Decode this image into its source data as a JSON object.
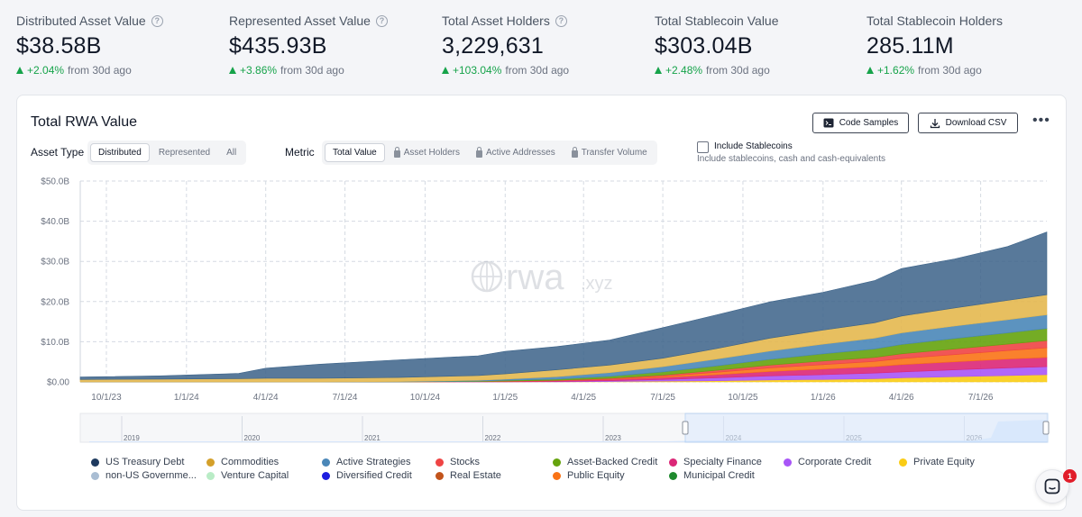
{
  "stats": [
    {
      "label": "Distributed Asset Value",
      "info": true,
      "value": "$38.58B",
      "change": "+2.04%",
      "suffix": "from 30d ago"
    },
    {
      "label": "Represented Asset Value",
      "info": true,
      "value": "$435.93B",
      "change": "+3.86%",
      "suffix": "from 30d ago"
    },
    {
      "label": "Total Asset Holders",
      "info": true,
      "value": "3,229,631",
      "change": "+103.04%",
      "suffix": "from 30d ago"
    },
    {
      "label": "Total Stablecoin Value",
      "info": false,
      "value": "$303.04B",
      "change": "+2.48%",
      "suffix": "from 30d ago"
    },
    {
      "label": "Total Stablecoin Holders",
      "info": false,
      "value": "285.11M",
      "change": "+1.62%",
      "suffix": "from 30d ago"
    }
  ],
  "card": {
    "title": "Total RWA Value",
    "code_samples": "Code Samples",
    "download_csv": "Download CSV",
    "more": "•••"
  },
  "controls": {
    "asset_type_label": "Asset Type",
    "asset_type_options": [
      "Distributed",
      "Represented",
      "All"
    ],
    "asset_type_selected": "Distributed",
    "metric_label": "Metric",
    "metric_options": [
      "Total Value",
      "Asset Holders",
      "Active Addresses",
      "Transfer Volume"
    ],
    "metric_selected": "Total Value",
    "include_stablecoins_label": "Include Stablecoins",
    "include_stablecoins_sub": "Include stablecoins, cash and cash-equivalents",
    "include_stablecoins_checked": false
  },
  "watermark": {
    "main": "rwa",
    "suffix": ".xyz"
  },
  "chart_data": {
    "type": "area",
    "stacked": true,
    "ylim": [
      0,
      50
    ],
    "y_ticks": [
      0,
      10,
      20,
      30,
      40,
      50
    ],
    "y_tick_labels": [
      "$0.00",
      "$10.0B",
      "$20.0B",
      "$30.0B",
      "$40.0B",
      "$50.0B"
    ],
    "x_ticks": [
      "2023-10-01",
      "2024-01-01",
      "2024-04-01",
      "2024-07-01",
      "2024-10-01",
      "2025-01-01",
      "2025-04-01",
      "2025-07-01",
      "2025-10-01",
      "2026-01-01",
      "2026-04-01",
      "2026-07-01"
    ],
    "x_tick_labels": [
      "10/1/23",
      "1/1/24",
      "4/1/24",
      "7/1/24",
      "10/1/24",
      "1/1/25",
      "4/1/25",
      "7/1/25",
      "10/1/25",
      "1/1/26",
      "4/1/26",
      "7/1/26"
    ],
    "x_range": [
      "2023-09-01",
      "2026-09-15"
    ],
    "grid": true,
    "x": [
      "2023-09-01",
      "2023-12-01",
      "2024-03-01",
      "2024-04-01",
      "2024-06-01",
      "2024-09-01",
      "2024-12-01",
      "2025-01-01",
      "2025-03-01",
      "2025-05-01",
      "2025-07-01",
      "2025-09-01",
      "2025-11-01",
      "2026-01-01",
      "2026-03-01",
      "2026-04-01",
      "2026-06-01",
      "2026-08-01",
      "2026-09-15"
    ],
    "series": [
      {
        "name": "Private Equity",
        "color": "#facc15",
        "values": [
          0,
          0,
          0,
          0,
          0,
          0,
          0,
          0,
          0,
          0.1,
          0.2,
          0.3,
          0.5,
          0.6,
          0.8,
          1.0,
          1.3,
          1.6,
          1.8
        ]
      },
      {
        "name": "Corporate Credit",
        "color": "#a855f7",
        "values": [
          0,
          0,
          0,
          0,
          0,
          0,
          0,
          0,
          0.1,
          0.2,
          0.4,
          0.7,
          1.0,
          1.2,
          1.4,
          1.5,
          1.7,
          1.9,
          2.0
        ]
      },
      {
        "name": "Specialty Finance",
        "color": "#db2777",
        "values": [
          0,
          0,
          0,
          0,
          0,
          0,
          0.1,
          0.1,
          0.2,
          0.3,
          0.5,
          0.8,
          1.1,
          1.4,
          1.6,
          1.8,
          2.0,
          2.2,
          2.3
        ]
      },
      {
        "name": "Public Equity",
        "color": "#f97316",
        "values": [
          0,
          0,
          0,
          0,
          0,
          0,
          0,
          0,
          0,
          0.1,
          0.3,
          0.6,
          0.9,
          1.1,
          1.3,
          1.5,
          1.8,
          2.1,
          2.4
        ]
      },
      {
        "name": "Stocks",
        "color": "#ef4444",
        "values": [
          0,
          0,
          0,
          0,
          0,
          0,
          0,
          0.1,
          0.1,
          0.2,
          0.3,
          0.5,
          0.7,
          0.9,
          1.0,
          1.2,
          1.4,
          1.6,
          1.8
        ]
      },
      {
        "name": "Asset-Backed Credit",
        "color": "#65a30d",
        "values": [
          0,
          0,
          0,
          0,
          0,
          0,
          0.1,
          0.2,
          0.3,
          0.5,
          0.8,
          1.1,
          1.4,
          1.8,
          2.1,
          2.3,
          2.6,
          2.8,
          3.0
        ]
      },
      {
        "name": "Active Strategies",
        "color": "#4a87b8",
        "values": [
          0,
          0,
          0,
          0,
          0,
          0.1,
          0.2,
          0.3,
          0.6,
          0.9,
          1.3,
          1.7,
          2.1,
          2.4,
          2.7,
          2.9,
          3.1,
          3.3,
          3.4
        ]
      },
      {
        "name": "Commodities",
        "color": "#e4b84f",
        "values": [
          0.6,
          0.7,
          0.8,
          0.9,
          0.9,
          1.0,
          1.2,
          1.3,
          1.7,
          1.9,
          2.1,
          2.6,
          3.2,
          3.5,
          3.8,
          4.2,
          4.5,
          4.8,
          5.0
        ]
      },
      {
        "name": "US Treasury Debt",
        "color": "#3b6288",
        "values": [
          0.6,
          0.8,
          1.3,
          2.5,
          3.5,
          4.4,
          4.9,
          5.6,
          5.8,
          6.2,
          7.6,
          8.4,
          9.0,
          9.4,
          10.5,
          11.8,
          12.2,
          13.4,
          15.6
        ]
      }
    ]
  },
  "navigator": {
    "years": [
      "2019",
      "2020",
      "2021",
      "2022",
      "2023",
      "2024",
      "2025",
      "2026"
    ]
  },
  "legend": [
    {
      "name": "US Treasury Debt",
      "color": "#1e3a5f"
    },
    {
      "name": "Commodities",
      "color": "#d4a02a"
    },
    {
      "name": "Active Strategies",
      "color": "#4a87b8"
    },
    {
      "name": "Stocks",
      "color": "#ef4444"
    },
    {
      "name": "Asset-Backed Credit",
      "color": "#65a30d"
    },
    {
      "name": "Specialty Finance",
      "color": "#db2777"
    },
    {
      "name": "Corporate Credit",
      "color": "#a855f7"
    },
    {
      "name": "Private Equity",
      "color": "#facc15"
    },
    {
      "name": "non-US Governme...",
      "color": "#a9bdd3"
    },
    {
      "name": "Venture Capital",
      "color": "#b9ecc6"
    },
    {
      "name": "Diversified Credit",
      "color": "#1d1de0"
    },
    {
      "name": "Real Estate",
      "color": "#c2541c"
    },
    {
      "name": "Public Equity",
      "color": "#f97316"
    },
    {
      "name": "Municipal Credit",
      "color": "#1f8a2e"
    }
  ],
  "chat": {
    "badge": "1"
  }
}
